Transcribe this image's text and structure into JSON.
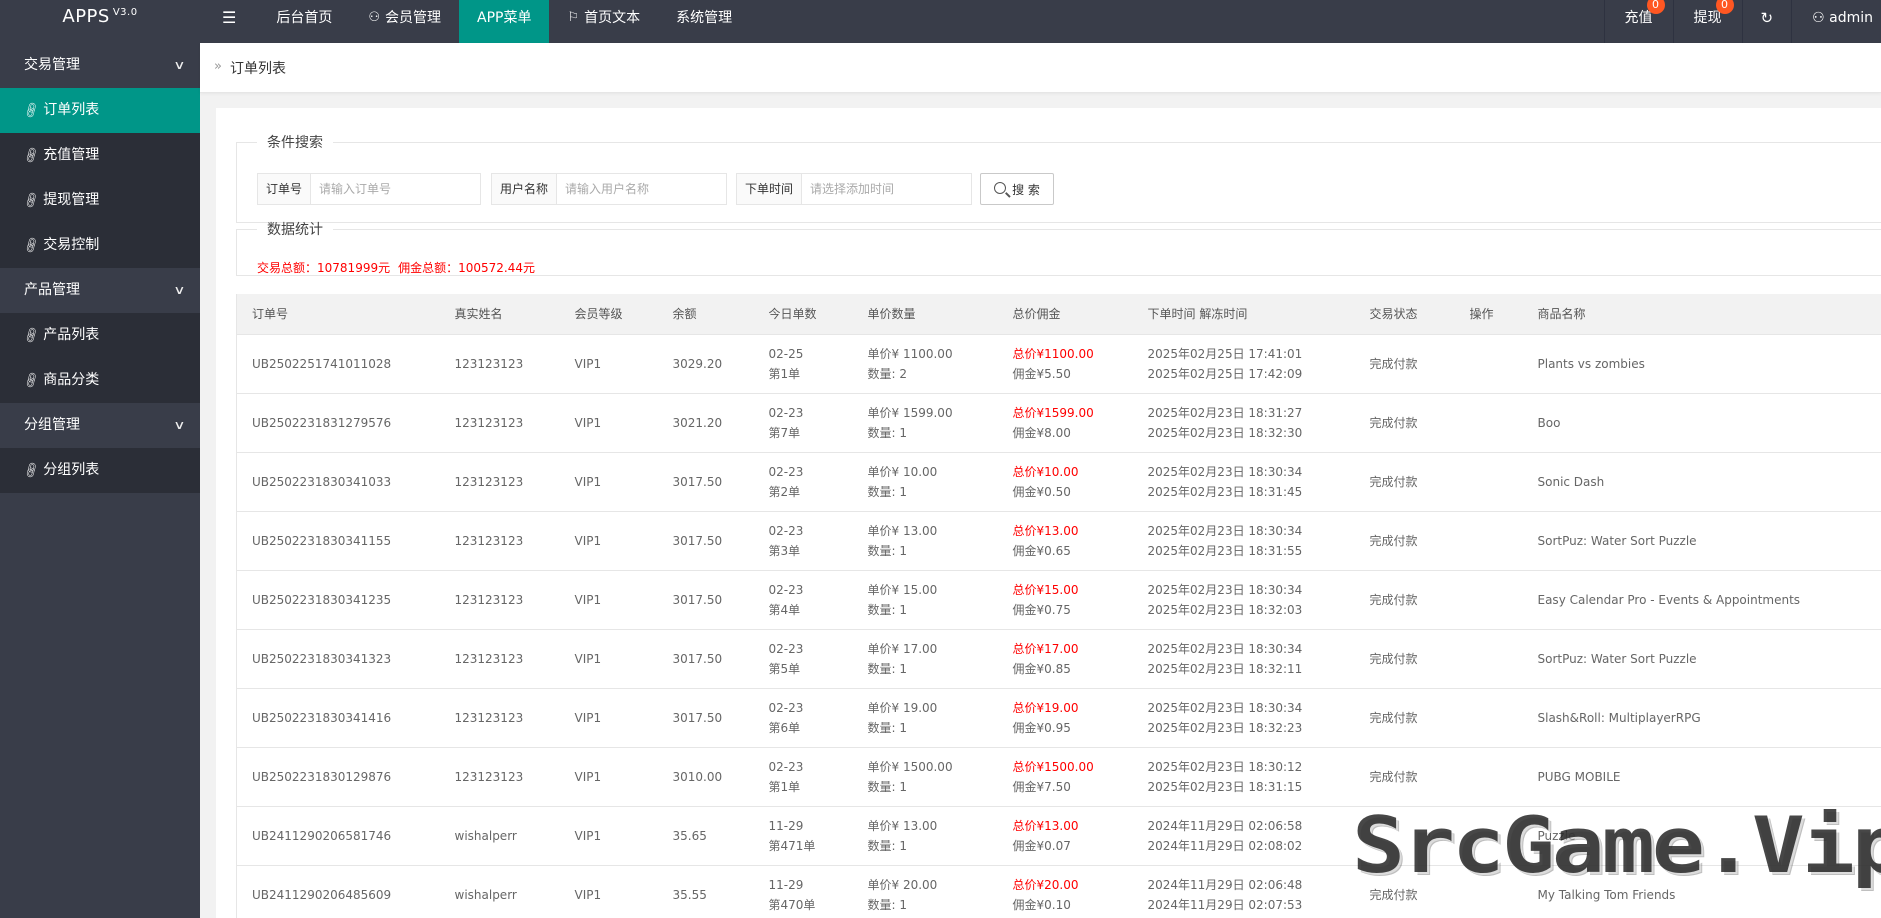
{
  "app": {
    "logo": "APPS",
    "version": "V3.0"
  },
  "header": {
    "nav": [
      {
        "label": "后台首页",
        "icon": ""
      },
      {
        "label": "会员管理",
        "icon": "user-icon"
      },
      {
        "label": "APP菜单",
        "icon": "",
        "active": true
      },
      {
        "label": "首页文本",
        "icon": "flag-icon"
      },
      {
        "label": "系统管理",
        "icon": ""
      }
    ],
    "recharge": {
      "label": "充值",
      "badge": "0"
    },
    "withdraw": {
      "label": "提现",
      "badge": "0"
    },
    "user": "admin"
  },
  "sidebar": {
    "groups": [
      {
        "label": "交易管理",
        "items": [
          "订单列表",
          "充值管理",
          "提现管理",
          "交易控制"
        ]
      },
      {
        "label": "产品管理",
        "items": [
          "产品列表",
          "商品分类"
        ]
      },
      {
        "label": "分组管理",
        "items": [
          "分组列表"
        ]
      }
    ],
    "active_item": "订单列表"
  },
  "breadcrumb": "订单列表",
  "search": {
    "legend": "条件搜索",
    "order_no": {
      "label": "订单号",
      "placeholder": "请输入订单号"
    },
    "username": {
      "label": "用户名称",
      "placeholder": "请输入用户名称"
    },
    "order_time": {
      "label": "下单时间",
      "placeholder": "请选择添加时间"
    },
    "button": "搜 索"
  },
  "stats": {
    "legend": "数据统计",
    "total_trade_label": "交易总额：",
    "total_trade": "10781999元",
    "total_commission_label": "佣金总额：",
    "total_commission": "100572.44元"
  },
  "table": {
    "columns": [
      "订单号",
      "真实姓名",
      "会员等级",
      "余额",
      "今日单数",
      "单价数量",
      "总价佣金",
      "下单时间 解冻时间",
      "交易状态",
      "操作",
      "商品名称"
    ],
    "rows": [
      {
        "order_no": "UB2502251741011028",
        "name": "123123123",
        "level": "VIP1",
        "balance": "3029.20",
        "date": "02-25",
        "nth": "第1单",
        "price": "单价¥  1100.00",
        "qty": "数量:  2",
        "total": "总价¥1100.00",
        "commission": "佣金¥5.50",
        "order_time": "2025年02月25日 17:41:01",
        "unfreeze_time": "2025年02月25日 17:42:09",
        "status": "完成付款",
        "product": "Plants vs zombies"
      },
      {
        "order_no": "UB2502231831279576",
        "name": "123123123",
        "level": "VIP1",
        "balance": "3021.20",
        "date": "02-23",
        "nth": "第7单",
        "price": "单价¥  1599.00",
        "qty": "数量:  1",
        "total": "总价¥1599.00",
        "commission": "佣金¥8.00",
        "order_time": "2025年02月23日 18:31:27",
        "unfreeze_time": "2025年02月23日 18:32:30",
        "status": "完成付款",
        "product": "Boo"
      },
      {
        "order_no": "UB2502231830341033",
        "name": "123123123",
        "level": "VIP1",
        "balance": "3017.50",
        "date": "02-23",
        "nth": "第2单",
        "price": "单价¥  10.00",
        "qty": "数量:  1",
        "total": "总价¥10.00",
        "commission": "佣金¥0.50",
        "order_time": "2025年02月23日 18:30:34",
        "unfreeze_time": "2025年02月23日 18:31:45",
        "status": "完成付款",
        "product": "Sonic Dash"
      },
      {
        "order_no": "UB2502231830341155",
        "name": "123123123",
        "level": "VIP1",
        "balance": "3017.50",
        "date": "02-23",
        "nth": "第3单",
        "price": "单价¥  13.00",
        "qty": "数量:  1",
        "total": "总价¥13.00",
        "commission": "佣金¥0.65",
        "order_time": "2025年02月23日 18:30:34",
        "unfreeze_time": "2025年02月23日 18:31:55",
        "status": "完成付款",
        "product": "SortPuz: Water Sort Puzzle"
      },
      {
        "order_no": "UB2502231830341235",
        "name": "123123123",
        "level": "VIP1",
        "balance": "3017.50",
        "date": "02-23",
        "nth": "第4单",
        "price": "单价¥  15.00",
        "qty": "数量:  1",
        "total": "总价¥15.00",
        "commission": "佣金¥0.75",
        "order_time": "2025年02月23日 18:30:34",
        "unfreeze_time": "2025年02月23日 18:32:03",
        "status": "完成付款",
        "product": "Easy Calendar Pro - Events & Appointments"
      },
      {
        "order_no": "UB2502231830341323",
        "name": "123123123",
        "level": "VIP1",
        "balance": "3017.50",
        "date": "02-23",
        "nth": "第5单",
        "price": "单价¥  17.00",
        "qty": "数量:  1",
        "total": "总价¥17.00",
        "commission": "佣金¥0.85",
        "order_time": "2025年02月23日 18:30:34",
        "unfreeze_time": "2025年02月23日 18:32:11",
        "status": "完成付款",
        "product": "SortPuz: Water Sort Puzzle"
      },
      {
        "order_no": "UB2502231830341416",
        "name": "123123123",
        "level": "VIP1",
        "balance": "3017.50",
        "date": "02-23",
        "nth": "第6单",
        "price": "单价¥  19.00",
        "qty": "数量:  1",
        "total": "总价¥19.00",
        "commission": "佣金¥0.95",
        "order_time": "2025年02月23日 18:30:34",
        "unfreeze_time": "2025年02月23日 18:32:23",
        "status": "完成付款",
        "product": "Slash&Roll: MultiplayerRPG"
      },
      {
        "order_no": "UB2502231830129876",
        "name": "123123123",
        "level": "VIP1",
        "balance": "3010.00",
        "date": "02-23",
        "nth": "第1单",
        "price": "单价¥  1500.00",
        "qty": "数量:  1",
        "total": "总价¥1500.00",
        "commission": "佣金¥7.50",
        "order_time": "2025年02月23日 18:30:12",
        "unfreeze_time": "2025年02月23日 18:31:15",
        "status": "完成付款",
        "product": "PUBG MOBILE"
      },
      {
        "order_no": "UB2411290206581746",
        "name": "wishalperr",
        "level": "VIP1",
        "balance": "35.65",
        "date": "11-29",
        "nth": "第471单",
        "price": "单价¥  13.00",
        "qty": "数量:  1",
        "total": "总价¥13.00",
        "commission": "佣金¥0.07",
        "order_time": "2024年11月29日 02:06:58",
        "unfreeze_time": "2024年11月29日 02:08:02",
        "status": "",
        "product": "Puzzle"
      },
      {
        "order_no": "UB2411290206485609",
        "name": "wishalperr",
        "level": "VIP1",
        "balance": "35.55",
        "date": "11-29",
        "nth": "第470单",
        "price": "单价¥  20.00",
        "qty": "数量:  1",
        "total": "总价¥20.00",
        "commission": "佣金¥0.10",
        "order_time": "2024年11月29日 02:06:48",
        "unfreeze_time": "2024年11月29日 02:07:53",
        "status": "完成付款",
        "product": "My Talking Tom Friends"
      }
    ]
  },
  "watermark": "SrcGame.Vip",
  "colors": {
    "header_bg": "#393d49",
    "accent": "#009688",
    "badge": "#ff5722",
    "money_red": "#ff0000"
  }
}
